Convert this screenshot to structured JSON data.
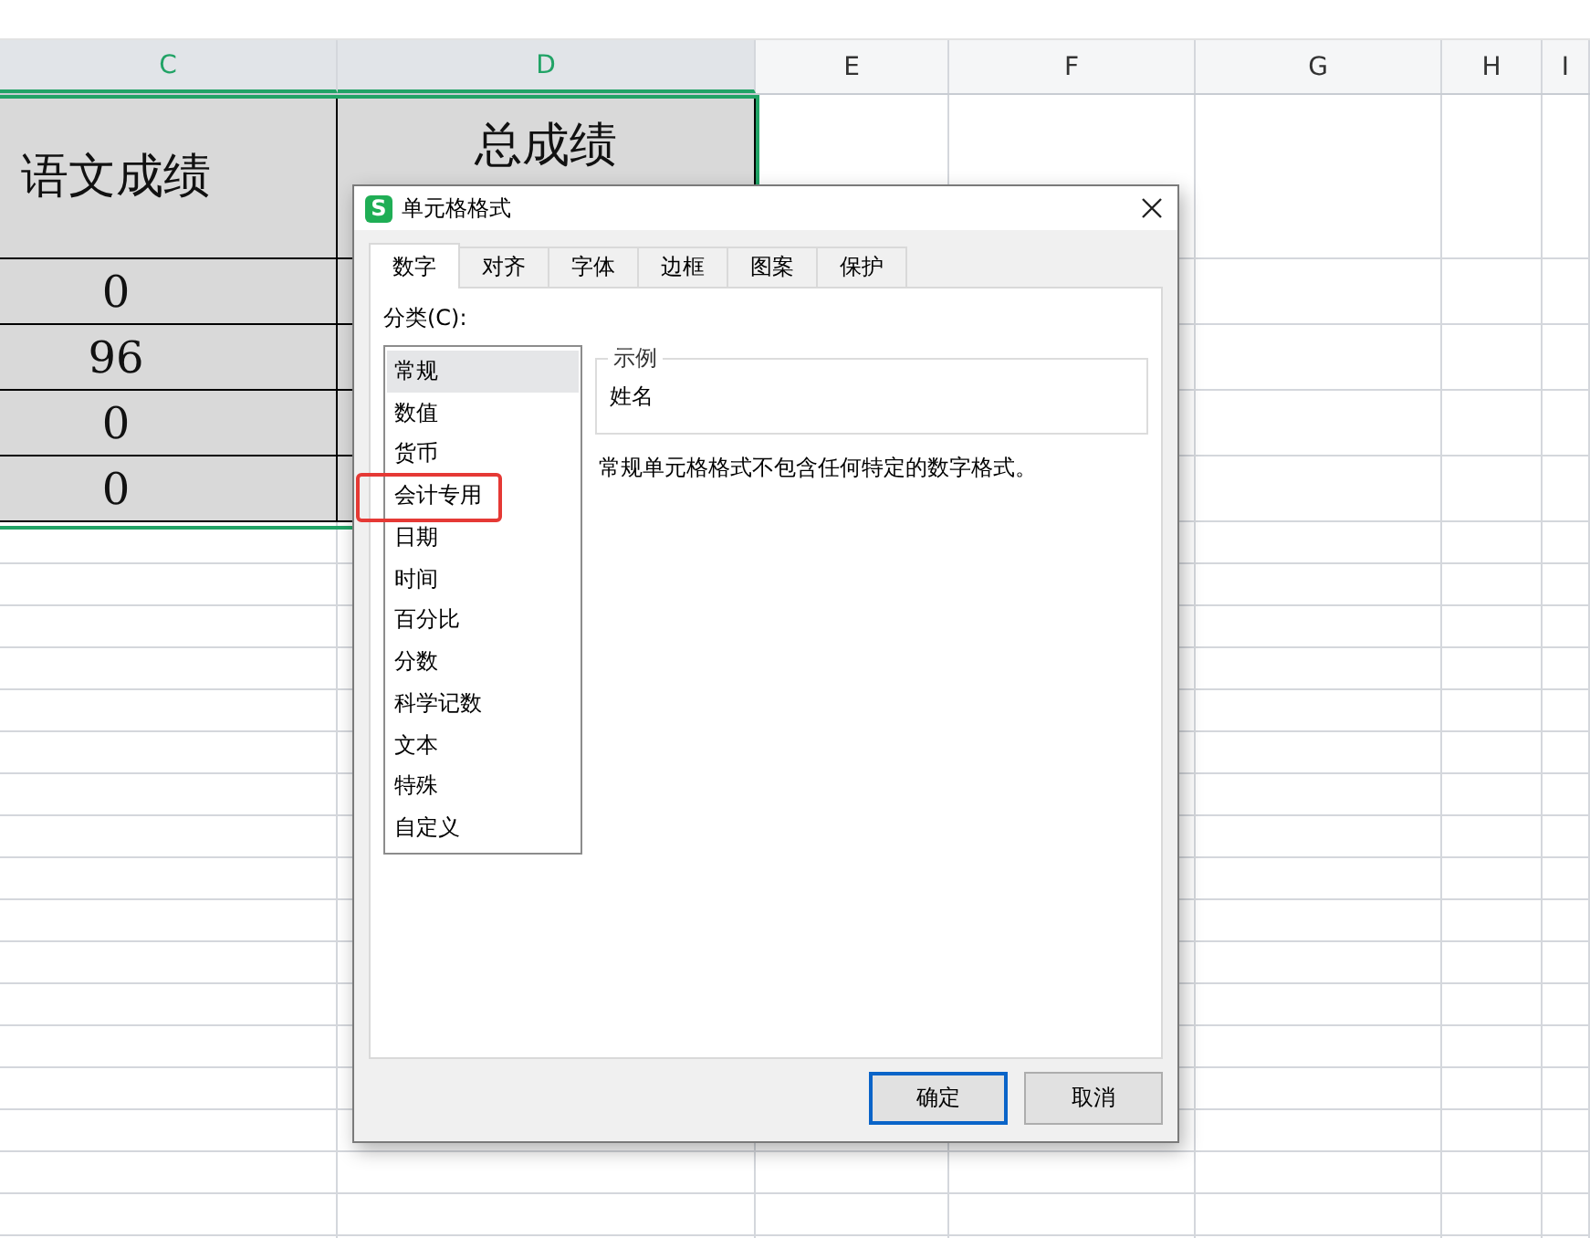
{
  "sheet": {
    "columns": [
      {
        "label": "C",
        "selected": true
      },
      {
        "label": "D",
        "selected": true
      },
      {
        "label": "E",
        "selected": false
      },
      {
        "label": "F",
        "selected": false
      },
      {
        "label": "G",
        "selected": false
      },
      {
        "label": "H",
        "selected": false
      },
      {
        "label": "I",
        "selected": false
      }
    ],
    "rows": [
      {
        "kind": "header",
        "cells": [
          "语文成绩",
          "总成绩"
        ]
      },
      {
        "kind": "data",
        "cells": [
          "0"
        ]
      },
      {
        "kind": "data",
        "cells": [
          "96"
        ]
      },
      {
        "kind": "data",
        "cells": [
          "0"
        ]
      },
      {
        "kind": "data",
        "cells": [
          "0"
        ]
      }
    ]
  },
  "dialog": {
    "logo": "S",
    "title": "单元格格式",
    "tabs": [
      {
        "label": "数字",
        "selected": true
      },
      {
        "label": "对齐",
        "selected": false
      },
      {
        "label": "字体",
        "selected": false
      },
      {
        "label": "边框",
        "selected": false
      },
      {
        "label": "图案",
        "selected": false
      },
      {
        "label": "保护",
        "selected": false
      }
    ],
    "category_label": "分类(C):",
    "categories": [
      {
        "label": "常规",
        "selected": true,
        "highlighted": false
      },
      {
        "label": "数值",
        "selected": false,
        "highlighted": false
      },
      {
        "label": "货币",
        "selected": false,
        "highlighted": false
      },
      {
        "label": "会计专用",
        "selected": false,
        "highlighted": true
      },
      {
        "label": "日期",
        "selected": false,
        "highlighted": false
      },
      {
        "label": "时间",
        "selected": false,
        "highlighted": false
      },
      {
        "label": "百分比",
        "selected": false,
        "highlighted": false
      },
      {
        "label": "分数",
        "selected": false,
        "highlighted": false
      },
      {
        "label": "科学记数",
        "selected": false,
        "highlighted": false
      },
      {
        "label": "文本",
        "selected": false,
        "highlighted": false
      },
      {
        "label": "特殊",
        "selected": false,
        "highlighted": false
      },
      {
        "label": "自定义",
        "selected": false,
        "highlighted": false
      }
    ],
    "sample": {
      "legend": "示例",
      "value": "姓名"
    },
    "description": "常规单元格格式不包含任何特定的数字格式。",
    "buttons": [
      {
        "label": "确定",
        "default": true
      },
      {
        "label": "取消",
        "default": false
      }
    ]
  }
}
